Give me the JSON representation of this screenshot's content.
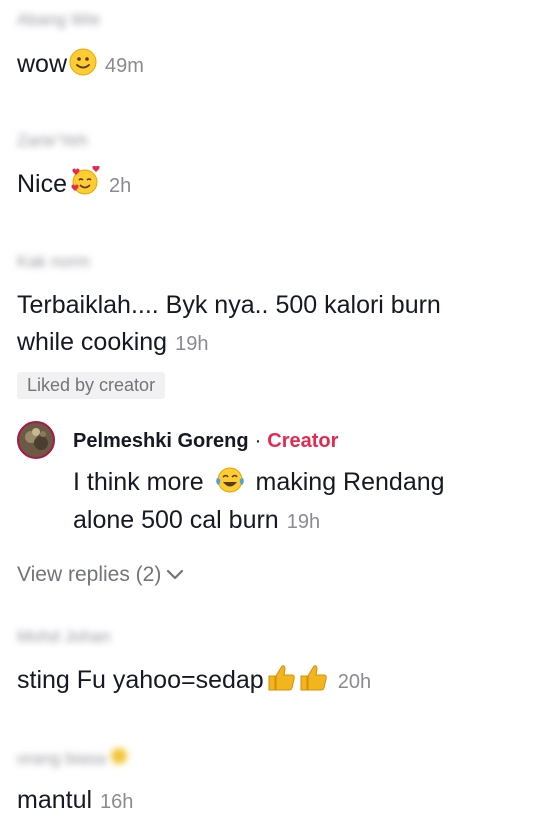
{
  "comments": [
    {
      "username": "Abang Wie",
      "text": "wow",
      "emoji": "slightly-smiling-face",
      "time": "49m"
    },
    {
      "username": "Zarie'Yeh",
      "text": "Nice",
      "emoji": "smiling-face-with-hearts",
      "time": "2h"
    },
    {
      "username": "Kak norm",
      "text_line1": "Terbaiklah.... Byk nya.. 500 kalori burn",
      "text_line2": "while cooking",
      "time": "19h",
      "badge": "Liked by creator"
    },
    {
      "username": "Mohd Johan",
      "text": "sting Fu yahoo=sedap",
      "emoji": "thumbs-up x2",
      "time": "20h"
    },
    {
      "username": "orang biasa",
      "text": "mantul",
      "time": "16h"
    }
  ],
  "reply": {
    "name": "Pelmeshki Goreng",
    "separator": "·",
    "role": "Creator",
    "text_line1_a": "I think more",
    "emoji": "face-with-tears-of-joy",
    "text_line1_b": "making Rendang",
    "text_line2": "alone 500 cal burn",
    "time": "19h"
  },
  "view_replies": "View replies (2)",
  "colors": {
    "text": "#161823",
    "muted": "#8a8b91",
    "creator": "#e8294f",
    "badge_bg": "#f1f1f2"
  }
}
